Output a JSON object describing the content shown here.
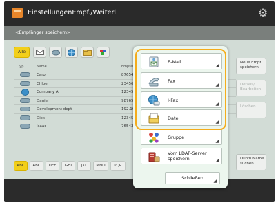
{
  "header": {
    "title": "EinstellungenEmpf./Weiterl.",
    "subtitle": "<Empfänger speichern>"
  },
  "filter_tabs": {
    "selected_label": "Alle"
  },
  "table": {
    "columns": [
      "Typ",
      "Name",
      "Empfän"
    ],
    "rows": [
      {
        "type_icon": "email-contact-icon",
        "name": "Carol",
        "value": "87654"
      },
      {
        "type_icon": "email-contact-icon",
        "name": "Chloe",
        "value": "23456"
      },
      {
        "type_icon": "globe-icon",
        "name": "Company A",
        "value": "12345"
      },
      {
        "type_icon": "email-contact-icon",
        "name": "Daniel",
        "value": "98765"
      },
      {
        "type_icon": "email-contact-icon",
        "name": "Development dept",
        "value": "192.16"
      },
      {
        "type_icon": "email-contact-icon",
        "name": "Dick",
        "value": "12345"
      },
      {
        "type_icon": "email-contact-icon",
        "name": "Isaac",
        "value": "76543"
      }
    ]
  },
  "side_buttons": {
    "new_recipient": "Neue Empf. speichern",
    "details_edit": "Details/ Bearbeiten",
    "delete": "Löschen",
    "search_by_name": "Durch Name suchen"
  },
  "alpha_tabs": [
    "ABC",
    "ABC",
    "DEF",
    "GHI",
    "JKL",
    "MNO",
    "PQR"
  ],
  "popup": {
    "items": [
      {
        "label": "E-Mail",
        "icon": "email-icon"
      },
      {
        "label": "Fax",
        "icon": "fax-icon"
      },
      {
        "label": "I-Fax",
        "icon": "i-fax-icon"
      },
      {
        "label": "Datei",
        "icon": "file-icon"
      },
      {
        "label": "Gruppe",
        "icon": "group-icon"
      },
      {
        "label": "Vom LDAP-Server speichern",
        "label_line1": "Vom LDAP-Server",
        "label_line2": "speichern",
        "icon": "ldap-server-icon"
      }
    ],
    "close_label": "Schließen"
  },
  "colors": {
    "accent_yellow": "#f2cf1a",
    "highlight_orange": "#f4ac1c",
    "title_bar": "#2a2a2a"
  }
}
